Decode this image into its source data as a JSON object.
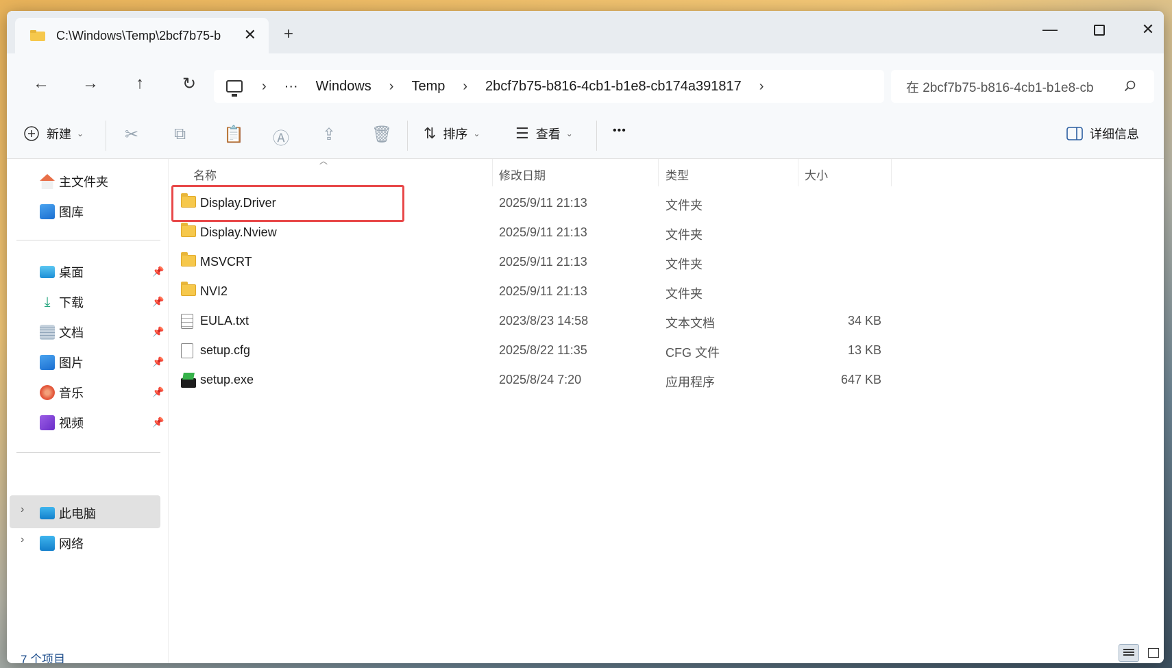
{
  "tab": {
    "title": "C:\\Windows\\Temp\\2bcf7b75-b",
    "close": "✕",
    "new": "+"
  },
  "window_controls": {
    "minimize": "—",
    "close": "✕"
  },
  "nav": {
    "back": "←",
    "forward": "→",
    "up": "↑",
    "refresh": "↻"
  },
  "address": {
    "ellipsis": "···",
    "segments": [
      "Windows",
      "Temp",
      "2bcf7b75-b816-4cb1-b1e8-cb174a391817"
    ],
    "chevron": "›"
  },
  "search": {
    "placeholder": "在 2bcf7b75-b816-4cb1-b1e8-cb"
  },
  "toolbar": {
    "new_label": "新建",
    "sort_label": "排序",
    "view_label": "查看",
    "more": "•••",
    "details_label": "详细信息"
  },
  "sidebar": {
    "home": "主文件夹",
    "gallery": "图库",
    "desktop": "桌面",
    "downloads": "下载",
    "documents": "文档",
    "pictures": "图片",
    "music": "音乐",
    "videos": "视频",
    "this_pc": "此电脑",
    "network": "网络"
  },
  "columns": {
    "name": "名称",
    "date": "修改日期",
    "type": "类型",
    "size": "大小"
  },
  "files": [
    {
      "name": "Display.Driver",
      "date": "2025/9/11 21:13",
      "type": "文件夹",
      "size": "",
      "icon": "folder-icon"
    },
    {
      "name": "Display.Nview",
      "date": "2025/9/11 21:13",
      "type": "文件夹",
      "size": "",
      "icon": "folder-icon"
    },
    {
      "name": "MSVCRT",
      "date": "2025/9/11 21:13",
      "type": "文件夹",
      "size": "",
      "icon": "folder-icon"
    },
    {
      "name": "NVI2",
      "date": "2025/9/11 21:13",
      "type": "文件夹",
      "size": "",
      "icon": "folder-icon"
    },
    {
      "name": "EULA.txt",
      "date": "2023/8/23 14:58",
      "type": "文本文档",
      "size": "34 KB",
      "icon": "text-file-icon"
    },
    {
      "name": "setup.cfg",
      "date": "2025/8/22 11:35",
      "type": "CFG 文件",
      "size": "13 KB",
      "icon": "file-icon"
    },
    {
      "name": "setup.exe",
      "date": "2025/8/24 7:20",
      "type": "应用程序",
      "size": "647 KB",
      "icon": "exe-icon"
    }
  ],
  "status": {
    "item_count": "7 个项目"
  },
  "colors": {
    "highlight": "#e8494a",
    "folder": "#f6c84c",
    "status_text": "#1e4e8c"
  }
}
